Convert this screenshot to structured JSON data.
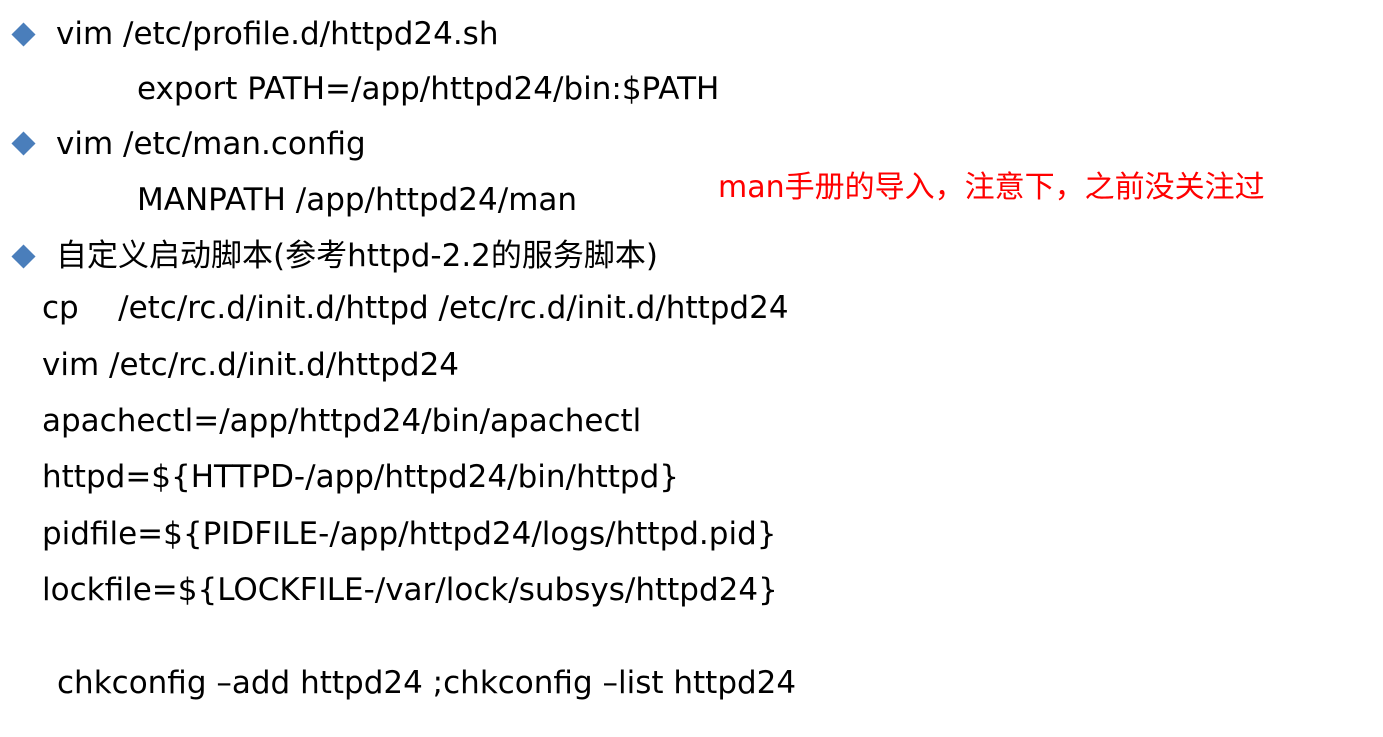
{
  "bullets": [
    {
      "icon": "diamond-bullet-icon",
      "color": "#4a7ebb",
      "text": "vim /etc/profile.d/httpd24.sh",
      "sub": "export PATH=/app/httpd24/bin:$PATH"
    },
    {
      "icon": "diamond-bullet-icon",
      "color": "#4a7ebb",
      "text": "vim /etc/man.config",
      "sub": "MANPATH /app/httpd24/man"
    },
    {
      "icon": "diamond-bullet-icon",
      "color": "#4a7ebb",
      "text": "自定义启动脚本(参考httpd-2.2的服务脚本)"
    }
  ],
  "annotation": {
    "text": "man手册的导入，注意下，之前没关注过",
    "color": "#ff0000"
  },
  "code_lines": [
    "cp    /etc/rc.d/init.d/httpd /etc/rc.d/init.d/httpd24",
    "vim /etc/rc.d/init.d/httpd24",
    "apachectl=/app/httpd24/bin/apachectl",
    "httpd=${HTTPD-/app/httpd24/bin/httpd}",
    "pidfile=${PIDFILE-/app/httpd24/logs/httpd.pid}",
    "lockfile=${LOCKFILE-/var/lock/subsys/httpd24}"
  ],
  "footer_command": "chkconfig –add httpd24 ;chkconfig –list httpd24"
}
